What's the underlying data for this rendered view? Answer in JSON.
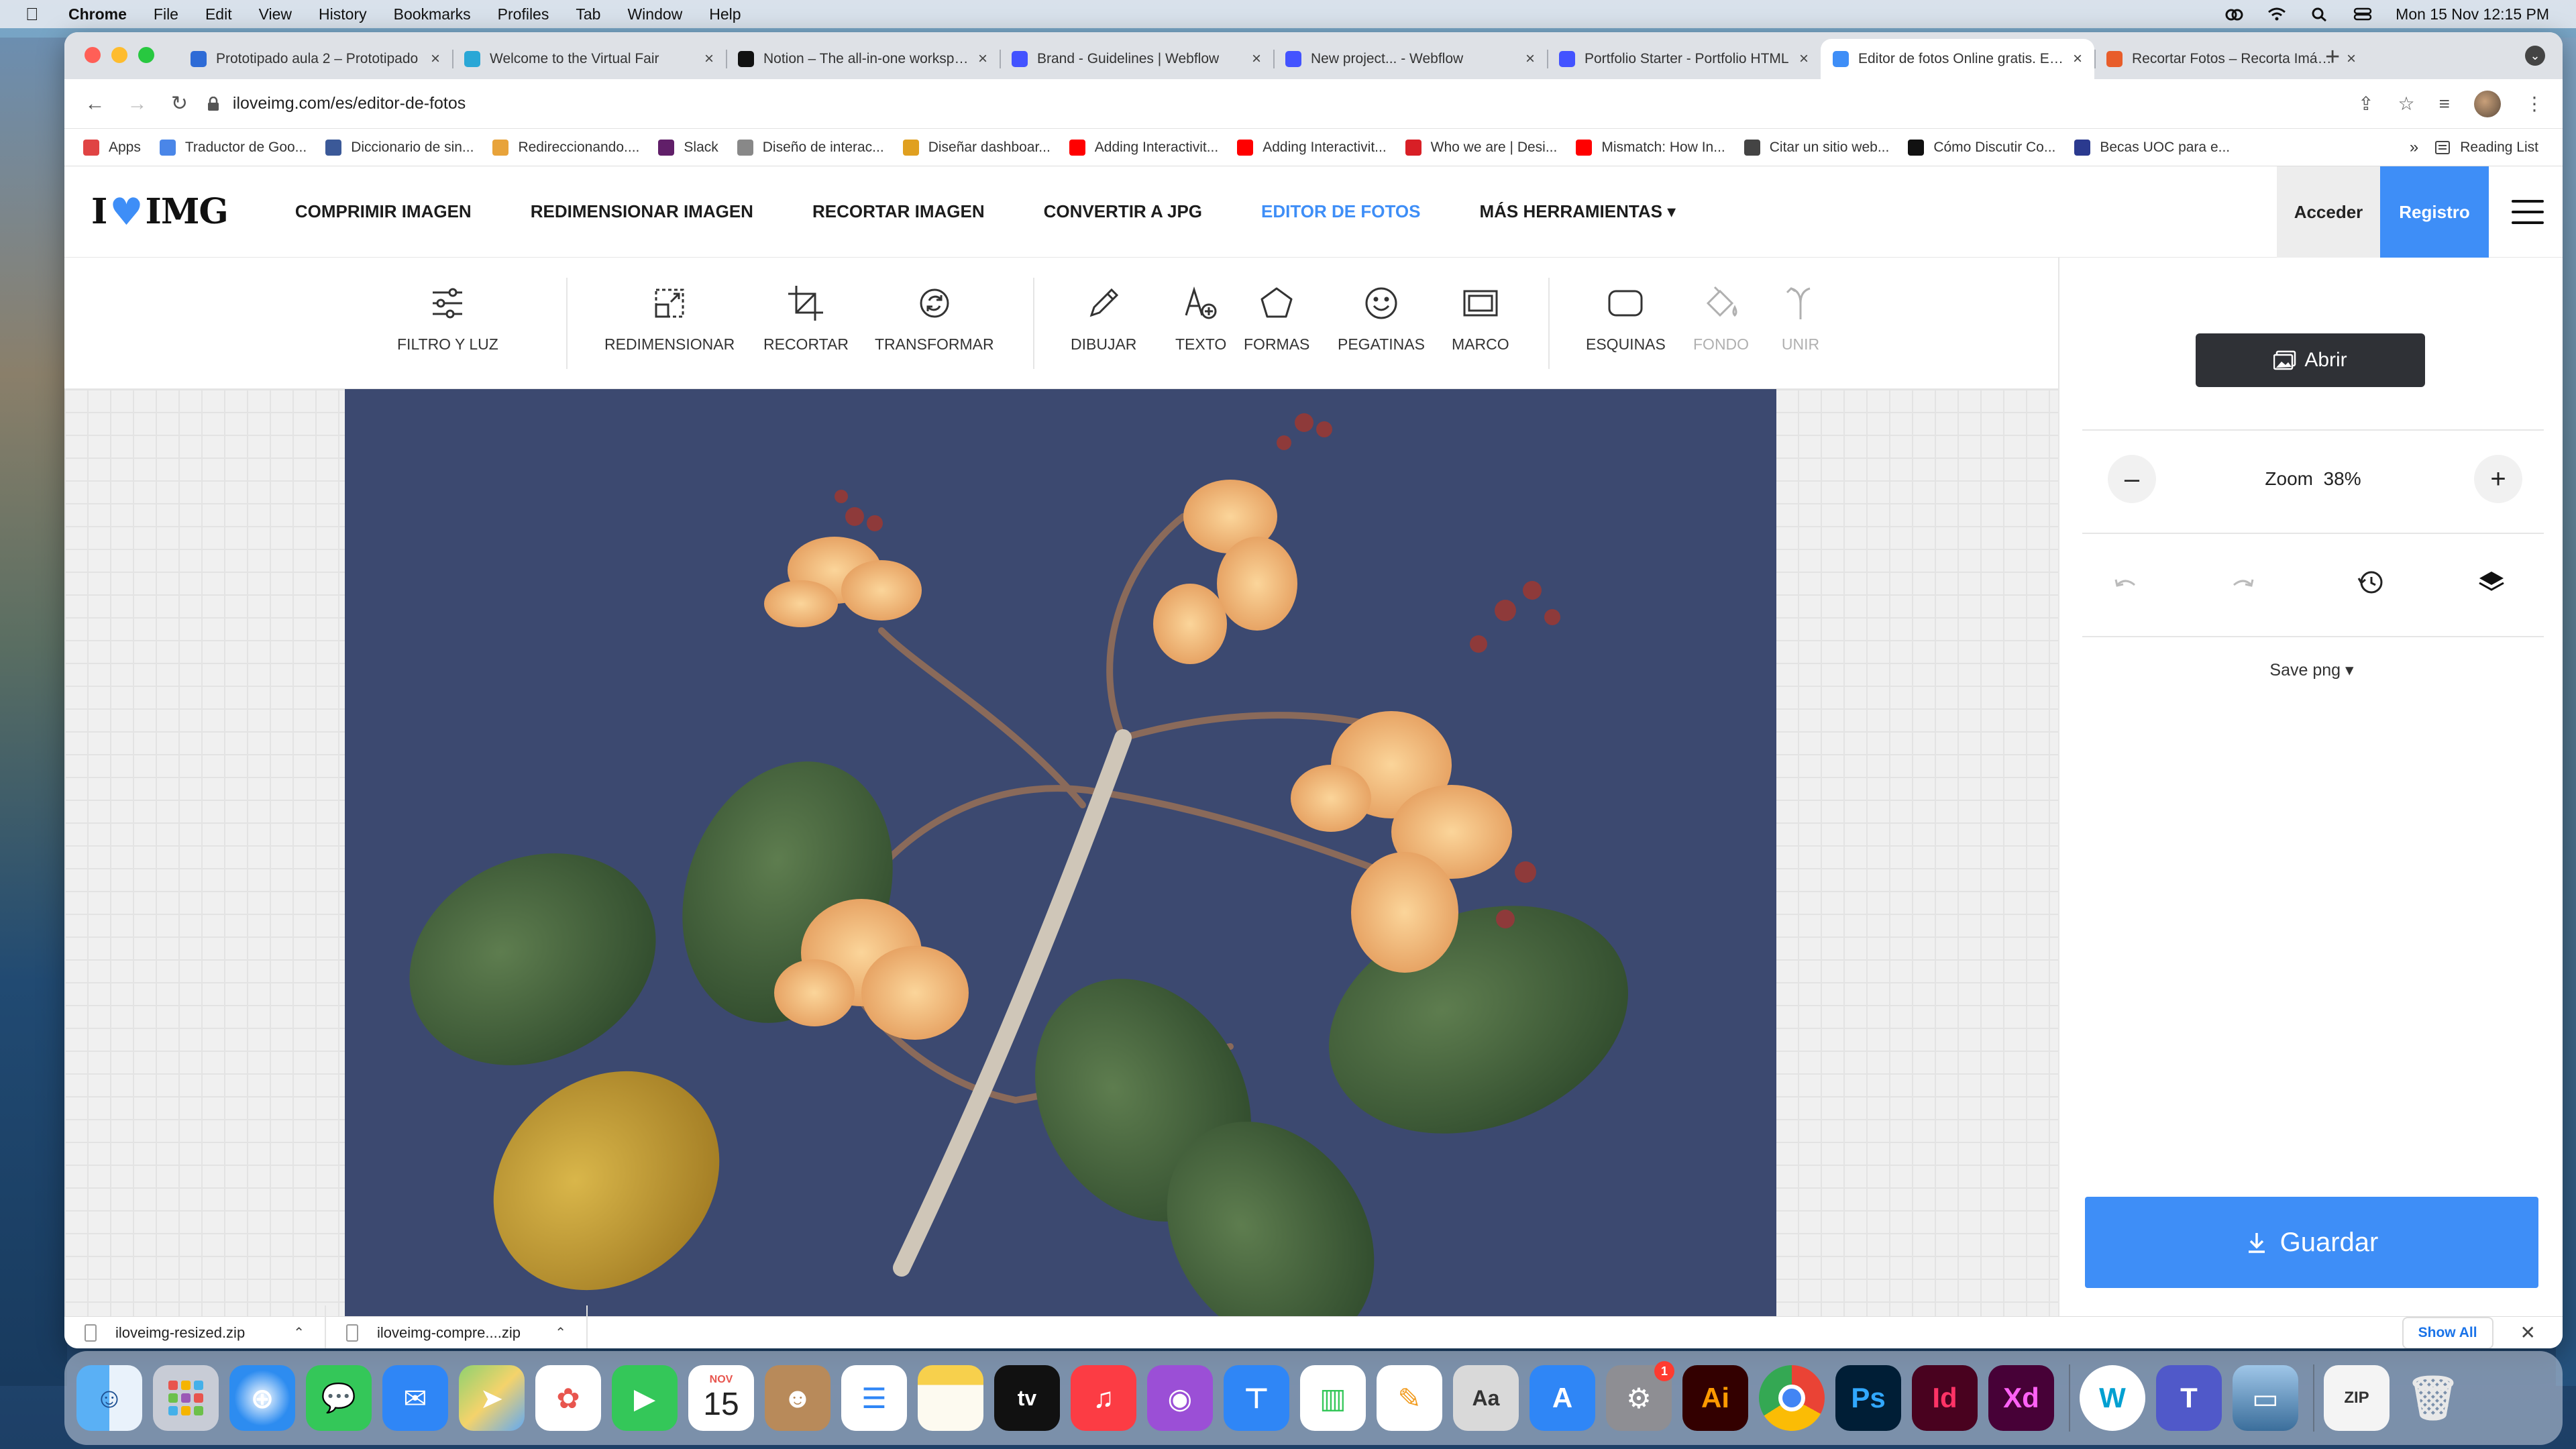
{
  "menubar": {
    "app": "Chrome",
    "items": [
      "File",
      "Edit",
      "View",
      "History",
      "Bookmarks",
      "Profiles",
      "Tab",
      "Window",
      "Help"
    ],
    "datetime": "Mon 15 Nov  12:15 PM"
  },
  "tabs": [
    {
      "title": "Prototipado aula 2 – Prototipado",
      "color": "#2e6bd6"
    },
    {
      "title": "Welcome to the Virtual Fair",
      "color": "#2aa7d6"
    },
    {
      "title": "Notion – The all-in-one workspace",
      "color": "#111111"
    },
    {
      "title": "Brand - Guidelines | Webflow",
      "color": "#4353ff"
    },
    {
      "title": "New project... - Webflow",
      "color": "#4353ff"
    },
    {
      "title": "Portfolio Starter - Portfolio HTML",
      "color": "#4353ff"
    },
    {
      "title": "Editor de fotos Online gratis. Edita",
      "color": "#3e8ef7"
    },
    {
      "title": "Recortar Fotos – Recorta Imágenes",
      "color": "#e85d2a"
    }
  ],
  "url": "iloveimg.com/es/editor-de-fotos",
  "bookmarks": [
    {
      "label": "Apps",
      "color": "#e04444"
    },
    {
      "label": "Traductor de Goo...",
      "color": "#4a86e8"
    },
    {
      "label": "Diccionario de sin...",
      "color": "#3b5998"
    },
    {
      "label": "Redireccionando....",
      "color": "#e8a33a"
    },
    {
      "label": "Slack",
      "color": "#611f69"
    },
    {
      "label": "Diseño de interac...",
      "color": "#888888"
    },
    {
      "label": "Diseñar dashboar...",
      "color": "#e0a020"
    },
    {
      "label": "Adding Interactivit...",
      "color": "#ff0000"
    },
    {
      "label": "Adding Interactivit...",
      "color": "#ff0000"
    },
    {
      "label": "Who we are | Desi...",
      "color": "#d81f26"
    },
    {
      "label": "Mismatch: How In...",
      "color": "#ff0000"
    },
    {
      "label": "Citar un sitio web...",
      "color": "#444444"
    },
    {
      "label": "Cómo Discutir Co...",
      "color": "#111111"
    },
    {
      "label": "Becas UOC para e...",
      "color": "#2b3a8f"
    }
  ],
  "reading_list": "Reading List",
  "site": {
    "logo_left": "I",
    "logo_right": "IMG",
    "nav": [
      "COMPRIMIR IMAGEN",
      "REDIMENSIONAR IMAGEN",
      "RECORTAR IMAGEN",
      "CONVERTIR A JPG",
      "EDITOR DE FOTOS",
      "MÁS HERRAMIENTAS ▾"
    ],
    "login": "Acceder",
    "signup": "Registro",
    "accent": "#3e8ef7"
  },
  "tools": [
    {
      "label": "FILTRO Y LUZ",
      "icon": "sliders-icon"
    },
    {
      "label": "REDIMENSIONAR",
      "icon": "resize-icon"
    },
    {
      "label": "RECORTAR",
      "icon": "crop-icon"
    },
    {
      "label": "TRANSFORMAR",
      "icon": "rotate-icon"
    },
    {
      "label": "DIBUJAR",
      "icon": "pencil-icon"
    },
    {
      "label": "TEXTO",
      "icon": "text-icon"
    },
    {
      "label": "FORMAS",
      "icon": "shapes-icon"
    },
    {
      "label": "PEGATINAS",
      "icon": "sticker-icon"
    },
    {
      "label": "MARCO",
      "icon": "frame-icon"
    },
    {
      "label": "ESQUINAS",
      "icon": "corners-icon"
    },
    {
      "label": "FONDO",
      "icon": "fill-icon"
    },
    {
      "label": "UNIR",
      "icon": "merge-icon"
    }
  ],
  "panel": {
    "open": "Abrir",
    "zoom_label": "Zoom",
    "zoom_value": "38%",
    "save_format": "Save png ▾",
    "save": "Guardar"
  },
  "downloads": [
    {
      "name": "iloveimg-resized.zip"
    },
    {
      "name": "iloveimg-compre....zip"
    }
  ],
  "show_all": "Show All",
  "dock": {
    "calendar_month": "NOV",
    "calendar_day": "15",
    "settings_badge": "1",
    "apps": [
      "finder-icon",
      "launchpad-icon",
      "safari-icon",
      "messages-icon",
      "mail-icon",
      "maps-icon",
      "photos-icon",
      "facetime-icon",
      "calendar-icon",
      "contacts-icon",
      "reminders-icon",
      "notes-icon",
      "appletv-icon",
      "music-icon",
      "podcasts-icon",
      "keynote-icon",
      "numbers-icon",
      "pages-icon",
      "font-book-icon",
      "app-store-icon",
      "system-preferences-icon",
      "illustrator-icon",
      "chrome-icon",
      "photoshop-icon",
      "indesign-icon",
      "xd-icon",
      "webex-icon",
      "teams-icon",
      "preview-icon",
      "archive-icon",
      "trash-icon"
    ]
  }
}
